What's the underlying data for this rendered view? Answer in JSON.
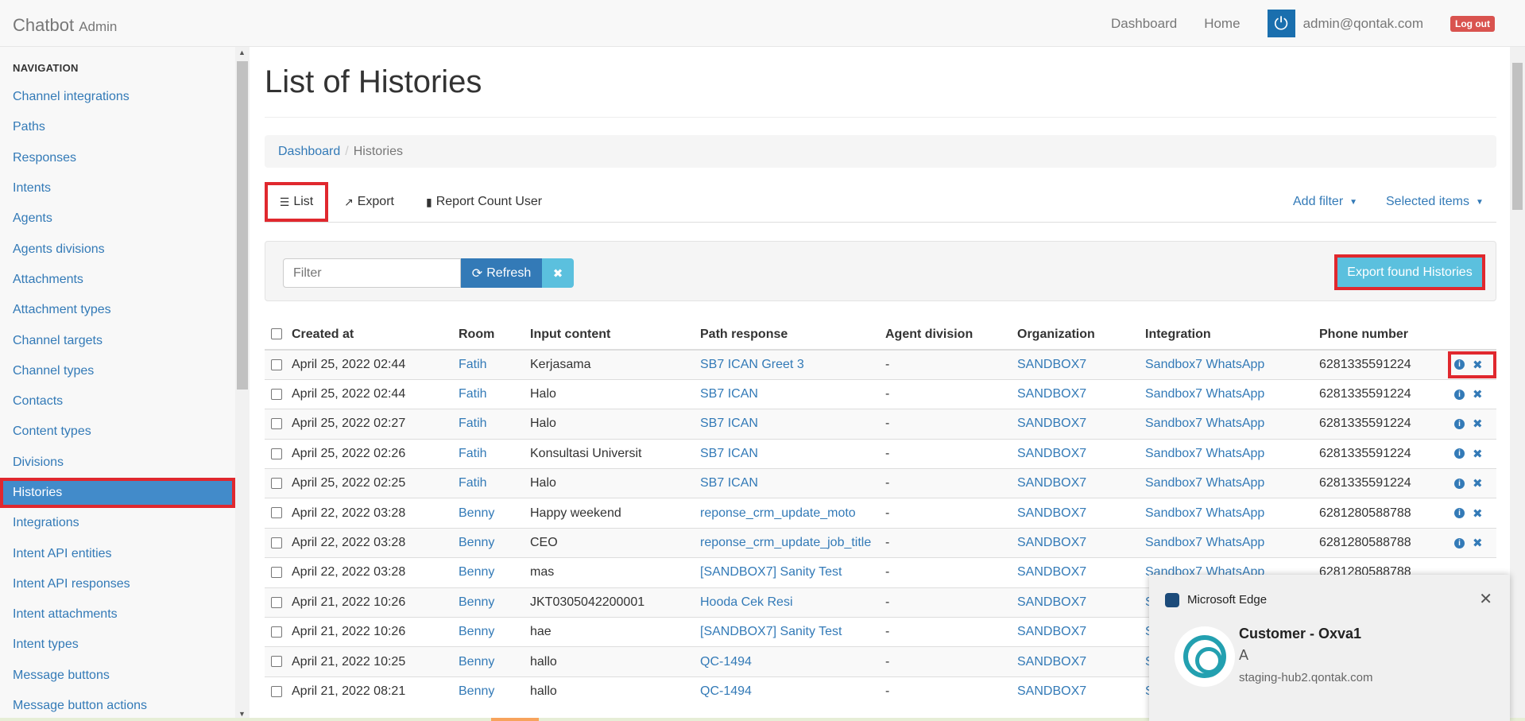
{
  "brand": {
    "name": "Chatbot",
    "sub": "Admin"
  },
  "topnav": {
    "dashboard": "Dashboard",
    "home": "Home",
    "user_email": "admin@qontak.com",
    "logout": "Log out"
  },
  "sidebar": {
    "heading": "NAVIGATION",
    "items": [
      {
        "label": "Channel integrations"
      },
      {
        "label": "Paths"
      },
      {
        "label": "Responses"
      },
      {
        "label": "Intents"
      },
      {
        "label": "Agents"
      },
      {
        "label": "Agents divisions"
      },
      {
        "label": "Attachments"
      },
      {
        "label": "Attachment types"
      },
      {
        "label": "Channel targets"
      },
      {
        "label": "Channel types"
      },
      {
        "label": "Contacts"
      },
      {
        "label": "Content types"
      },
      {
        "label": "Divisions"
      },
      {
        "label": "Histories",
        "active": true
      },
      {
        "label": "Integrations"
      },
      {
        "label": "Intent API entities"
      },
      {
        "label": "Intent API responses"
      },
      {
        "label": "Intent attachments"
      },
      {
        "label": "Intent types"
      },
      {
        "label": "Message buttons"
      },
      {
        "label": "Message button actions"
      }
    ]
  },
  "page": {
    "title": "List of Histories",
    "breadcrumb": {
      "link": "Dashboard",
      "separator": "/",
      "current": "Histories"
    },
    "tabs": {
      "list": "List",
      "export": "Export",
      "report": "Report Count User",
      "add_filter": "Add filter",
      "selected_items": "Selected items"
    },
    "filter": {
      "placeholder": "Filter",
      "refresh": "Refresh",
      "export_found": "Export found Histories"
    }
  },
  "table": {
    "headers": [
      "Created at",
      "Room",
      "Input content",
      "Path response",
      "Agent division",
      "Organization",
      "Integration",
      "Phone number"
    ],
    "rows": [
      [
        "April 25, 2022 02:44",
        "Fatih",
        "Kerjasama",
        "SB7 ICAN Greet 3",
        "-",
        "SANDBOX7",
        "Sandbox7 WhatsApp",
        "6281335591224"
      ],
      [
        "April 25, 2022 02:44",
        "Fatih",
        "Halo",
        "SB7 ICAN",
        "-",
        "SANDBOX7",
        "Sandbox7 WhatsApp",
        "6281335591224"
      ],
      [
        "April 25, 2022 02:27",
        "Fatih",
        "Halo",
        "SB7 ICAN",
        "-",
        "SANDBOX7",
        "Sandbox7 WhatsApp",
        "6281335591224"
      ],
      [
        "April 25, 2022 02:26",
        "Fatih",
        "Konsultasi Universit",
        "SB7 ICAN",
        "-",
        "SANDBOX7",
        "Sandbox7 WhatsApp",
        "6281335591224"
      ],
      [
        "April 25, 2022 02:25",
        "Fatih",
        "Halo",
        "SB7 ICAN",
        "-",
        "SANDBOX7",
        "Sandbox7 WhatsApp",
        "6281335591224"
      ],
      [
        "April 22, 2022 03:28",
        "Benny",
        "Happy weekend",
        "reponse_crm_update_moto",
        "-",
        "SANDBOX7",
        "Sandbox7 WhatsApp",
        "6281280588788"
      ],
      [
        "April 22, 2022 03:28",
        "Benny",
        "CEO",
        "reponse_crm_update_job_title",
        "-",
        "SANDBOX7",
        "Sandbox7 WhatsApp",
        "6281280588788"
      ],
      [
        "April 22, 2022 03:28",
        "Benny",
        "mas",
        "[SANDBOX7] Sanity Test",
        "-",
        "SANDBOX7",
        "Sandbox7 WhatsApp",
        "6281280588788"
      ],
      [
        "April 21, 2022 10:26",
        "Benny",
        "JKT0305042200001",
        "Hooda Cek Resi",
        "-",
        "SANDBOX7",
        "Sa",
        ""
      ],
      [
        "April 21, 2022 10:26",
        "Benny",
        "hae",
        "[SANDBOX7] Sanity Test",
        "-",
        "SANDBOX7",
        "Sa",
        ""
      ],
      [
        "April 21, 2022 10:25",
        "Benny",
        "hallo",
        "QC-1494",
        "-",
        "SANDBOX7",
        "Sa",
        ""
      ],
      [
        "April 21, 2022 08:21",
        "Benny",
        "hallo",
        "QC-1494",
        "-",
        "SANDBOX7",
        "Sa",
        ""
      ]
    ]
  },
  "toast": {
    "app": "Microsoft Edge",
    "title": "Customer - Oxva1",
    "body": "A",
    "source": "staging-hub2.qontak.com"
  },
  "colors": {
    "link": "#337ab7",
    "active": "#428bca",
    "highlight": "#e0282e",
    "info_button": "#5bc0de"
  }
}
